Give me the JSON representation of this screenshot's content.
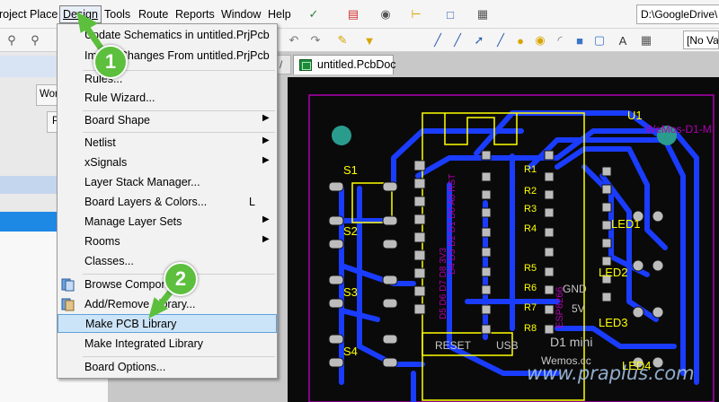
{
  "menubar": {
    "items": [
      "roject",
      "Place",
      "Design",
      "Tools",
      "Route",
      "Reports",
      "Window",
      "Help"
    ],
    "active": "Design"
  },
  "toolbar": {
    "path": "D:\\GoogleDrive\\",
    "variant": "[No Va"
  },
  "left_panel": {
    "btn1": "Wor",
    "btn2": "Pr"
  },
  "document_tab": {
    "label": "untitled.PcbDoc",
    "side_tab": "/"
  },
  "design_menu": {
    "items": [
      {
        "label": "Update Schematics in untitled.PrjPcb",
        "shortcut": "",
        "submenu": false
      },
      {
        "label": "Import Changes From untitled.PrjPcb",
        "shortcut": "",
        "submenu": false
      },
      {
        "label": "Rules...",
        "shortcut": "",
        "submenu": false
      },
      {
        "label": "Rule Wizard...",
        "shortcut": "",
        "submenu": false
      },
      {
        "label": "Board Shape",
        "shortcut": "",
        "submenu": true
      },
      {
        "label": "Netlist",
        "shortcut": "",
        "submenu": true
      },
      {
        "label": "xSignals",
        "shortcut": "",
        "submenu": true
      },
      {
        "label": "Layer Stack Manager...",
        "shortcut": "",
        "submenu": false
      },
      {
        "label": "Board Layers & Colors...",
        "shortcut": "L",
        "submenu": false
      },
      {
        "label": "Manage Layer Sets",
        "shortcut": "",
        "submenu": true
      },
      {
        "label": "Rooms",
        "shortcut": "",
        "submenu": true
      },
      {
        "label": "Classes...",
        "shortcut": "",
        "submenu": false
      },
      {
        "label": "Browse Components",
        "shortcut": "",
        "submenu": false
      },
      {
        "label": "Add/Remove Library...",
        "shortcut": "",
        "submenu": false
      },
      {
        "label": "Make PCB Library",
        "shortcut": "",
        "submenu": false
      },
      {
        "label": "Make Integrated Library",
        "shortcut": "",
        "submenu": false
      },
      {
        "label": "Board Options...",
        "shortcut": "",
        "submenu": false
      }
    ],
    "highlighted": "Make PCB Library"
  },
  "callouts": [
    "1",
    "2"
  ],
  "pcb": {
    "silkscreen": [
      "U1",
      "S1",
      "S2",
      "S3",
      "S4",
      "R1",
      "R2",
      "R3",
      "R4",
      "R5",
      "R6",
      "R7",
      "R8",
      "LED1",
      "LED2",
      "LED3",
      "LED4",
      "RESET",
      "USB",
      "GND",
      "5V",
      "D1 mini",
      "Wemos.cc",
      "WeMos-D1-M",
      "D4 D3 D2 D1 D0 A0 RST",
      "D5 D6 D7 D8 3V3",
      "ESP8266"
    ],
    "colors": {
      "board": "#0a0a0a",
      "top_copper": "#1a3cff",
      "silkscreen": "#ffff00",
      "pad": "#bcbcbc",
      "via": "#2a9c8e",
      "outline": "#b000b0"
    }
  },
  "watermark": "www.praplus.com"
}
